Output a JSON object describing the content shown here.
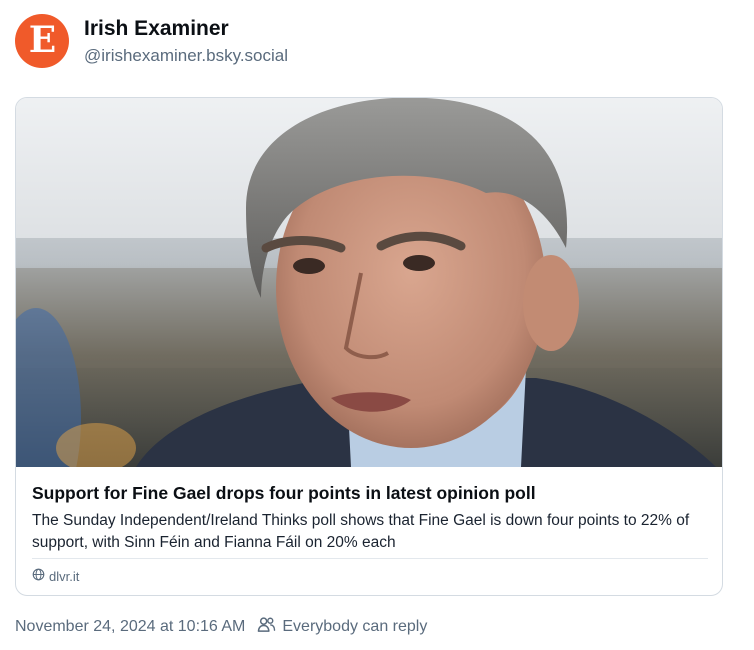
{
  "post": {
    "author": {
      "display_name": "Irish Examiner",
      "handle": "@irishexaminer.bsky.social",
      "avatar_letter": "E",
      "avatar_color": "#f05a2a"
    },
    "link_card": {
      "title": "Support for Fine Gael drops four points in latest opinion poll",
      "description": "The Sunday Independent/Ireland Thinks poll shows that Fine Gael is down four points to 22% of support, with Sinn Féin and Fianna Fáil on 20% each",
      "domain": "dlvr.it",
      "domain_icon": "globe-icon"
    },
    "timestamp": "November 24, 2024 at 10:16 AM",
    "reply_setting": {
      "icon": "people-icon",
      "label": "Everybody can reply"
    }
  }
}
